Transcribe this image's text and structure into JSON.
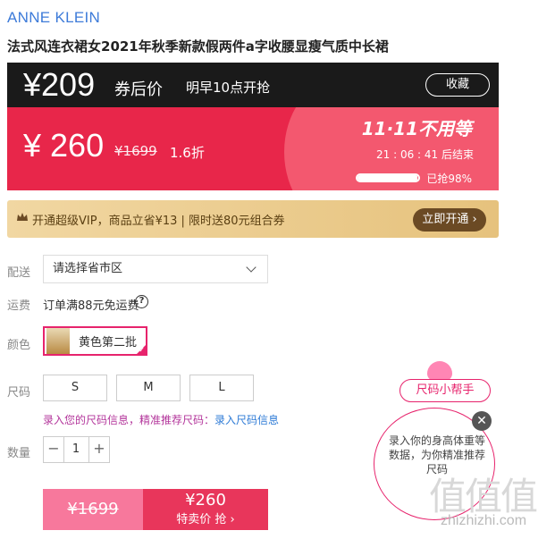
{
  "brand": "ANNE KLEIN",
  "product_title": "法式风连衣裙女2021年秋季新款假两件a字收腰显瘦气质中长裙",
  "promo": {
    "coupon_price": "¥209",
    "coupon_label": "券后价",
    "start_time": "明早10点开抢",
    "favorite_label": "收藏",
    "price": "¥ 260",
    "original_price": "¥1699",
    "discount": "1.6折",
    "slogan": "11·11不用等",
    "countdown": "21 : 06 : 41  后结束",
    "progress_pct": 98,
    "grab_label": "已抢98%"
  },
  "vip": {
    "text": "开通超级VIP，商品立省¥13 | 限时送80元组合券",
    "button": "立即开通 ›"
  },
  "delivery": {
    "label": "配送",
    "placeholder": "请选择省市区"
  },
  "shipping": {
    "label": "运费",
    "text": "订单满88元免运费",
    "help": "?"
  },
  "color": {
    "label": "颜色",
    "selected": "黄色第二批"
  },
  "size": {
    "label": "尺码",
    "options": [
      "S",
      "M",
      "L"
    ],
    "info_prefix": "录入您的尺码信息，精准推荐尺码：",
    "info_link": "录入尺码信息"
  },
  "quantity": {
    "label": "数量",
    "value": "1",
    "minus": "−",
    "plus": "+"
  },
  "buy": {
    "original": "¥1699",
    "price": "¥260",
    "action": "特卖价 抢 ›"
  },
  "size_helper": {
    "title": "尺码小帮手",
    "text": "录入你的身高体重等数据，为你精准推荐尺码",
    "close": "✕"
  },
  "watermark": {
    "logo": "值值值",
    "url": "zhizhizhi.com"
  }
}
